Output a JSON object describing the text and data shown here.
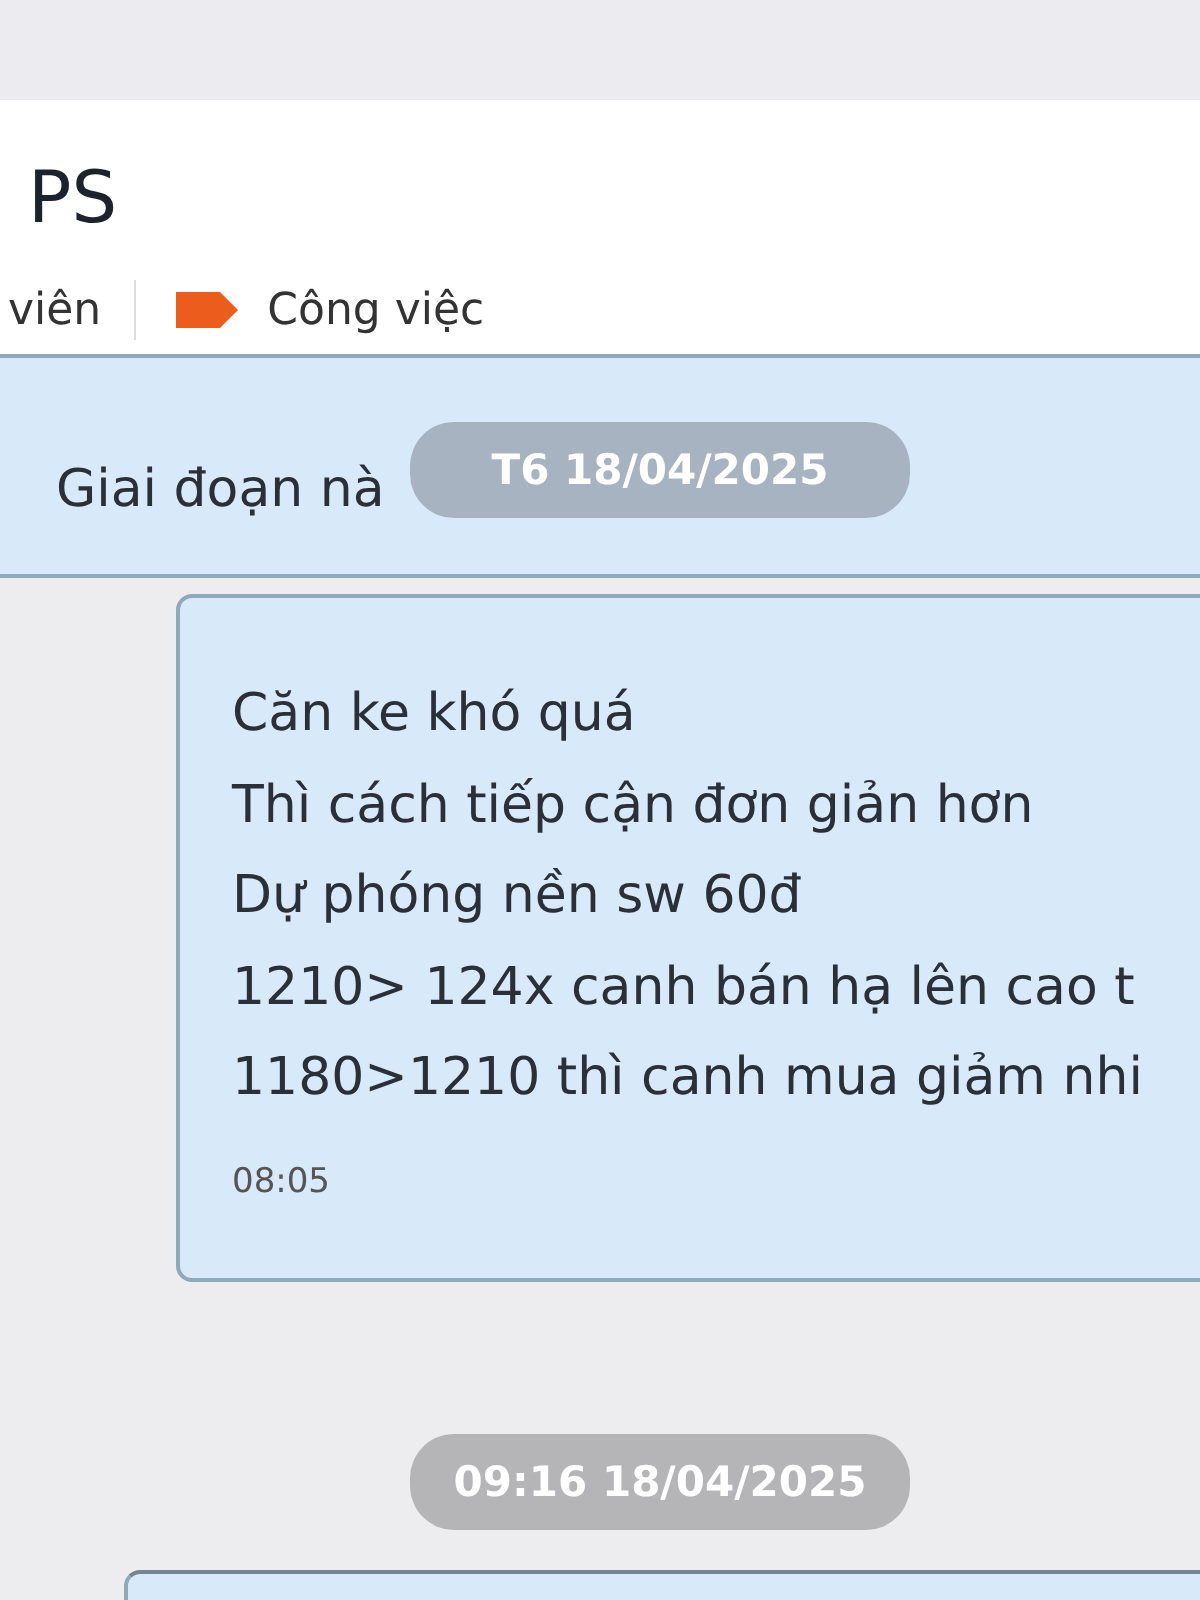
{
  "header": {
    "title": "PS",
    "member_label": "viên",
    "tag_label": "Công việc"
  },
  "messages": [
    {
      "kind": "bubble",
      "lines": [
        "Giai đoạn nà"
      ]
    },
    {
      "kind": "date_overlay",
      "text": "T6 18/04/2025"
    },
    {
      "kind": "bubble",
      "lines": [
        "Căn ke khó quá",
        "Thì cách tiếp cận đơn giản hơn",
        "Dự phóng nền sw 60đ",
        "1210> 124x canh bán hạ lên cao t",
        "1180>1210 thì canh mua giảm nhi"
      ],
      "time": "08:05"
    },
    {
      "kind": "date",
      "text": "09:16 18/04/2025"
    },
    {
      "kind": "bubble"
    }
  ]
}
